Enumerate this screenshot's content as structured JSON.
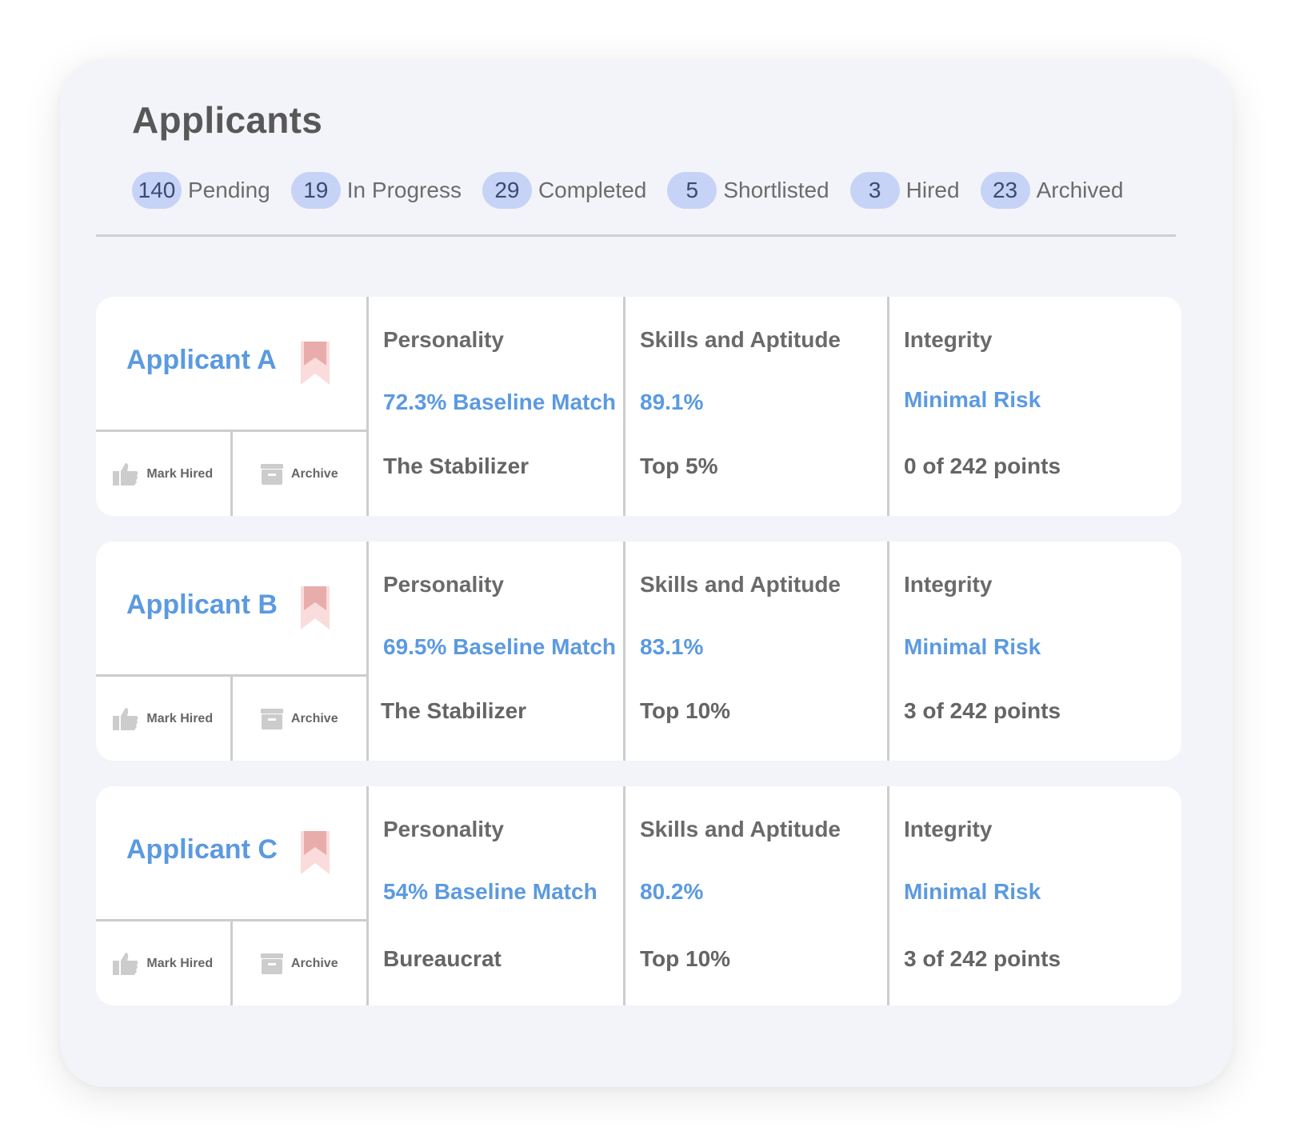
{
  "title": "Applicants",
  "stats": [
    {
      "count": "140",
      "label": "Pending"
    },
    {
      "count": "19",
      "label": "In Progress"
    },
    {
      "count": "29",
      "label": "Completed"
    },
    {
      "count": "5",
      "label": "Shortlisted"
    },
    {
      "count": "3",
      "label": "Hired"
    },
    {
      "count": "23",
      "label": "Archived"
    }
  ],
  "colors": {
    "accent": "#5b9ae0",
    "badge_bg": "#c6d3f7",
    "badge_text": "#3b4a73",
    "bookmark_dark": "#e8adab",
    "bookmark_light": "#f9dcdb",
    "icon_gray": "#cccccc"
  },
  "actions": {
    "mark_hired": "Mark Hired",
    "archive": "Archive"
  },
  "headers": {
    "personality": "Personality",
    "skills": "Skills and Aptitude",
    "integrity": "Integrity"
  },
  "applicants": [
    {
      "name": "Applicant A",
      "personality_match": "72.3% Baseline Match",
      "personality_type": "The Stabilizer",
      "skills_score": "89.1%",
      "skills_rank": "Top 5%",
      "integrity_risk": "Minimal Risk",
      "integrity_points": "0 of 242 points"
    },
    {
      "name": "Applicant B",
      "personality_match": "69.5% Baseline Match",
      "personality_type": "The Stabilizer",
      "skills_score": "83.1%",
      "skills_rank": "Top 10%",
      "integrity_risk": "Minimal Risk",
      "integrity_points": "3 of 242 points"
    },
    {
      "name": "Applicant C",
      "personality_match": "54% Baseline Match",
      "personality_type": "Bureaucrat",
      "skills_score": "80.2%",
      "skills_rank": "Top 10%",
      "integrity_risk": "Minimal Risk",
      "integrity_points": "3 of 242 points"
    }
  ]
}
